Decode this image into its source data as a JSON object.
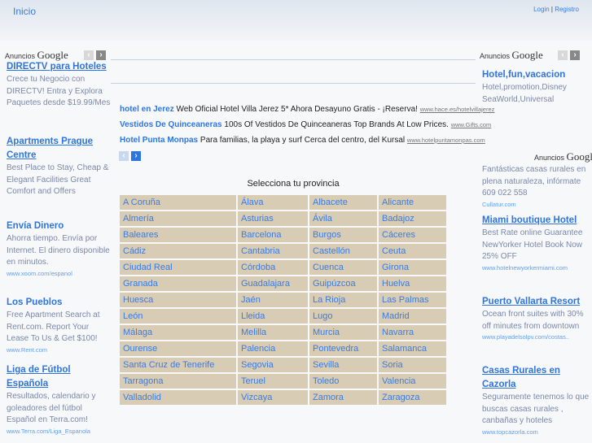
{
  "header": {
    "home": "Inicio",
    "login": "Login",
    "separator": "|",
    "register": "Registro"
  },
  "ads_label": {
    "prefix": "Anuncios",
    "brand": "Google"
  },
  "left_ads": [
    {
      "title": "DIRECTV para Hoteles",
      "desc": "Crece tu Negocio con DIRECTV! Entra y Explora Paquetes desde $19.99/Mes",
      "url": ""
    },
    {
      "title": "Apartments Prague Centre",
      "desc": "Best Place to Stay, Cheap & Elegant Facilities Great Comfort and Offers",
      "url": ""
    },
    {
      "title": "Envía Dinero",
      "desc": "Ahorra tiempo. Envía por Internet. El dinero disponible en minutos.",
      "url": "www.xoom.com/espanol"
    },
    {
      "title": "Los Pueblos",
      "desc": "Free Apartment Search at Rent.com. Report Your Lease To Us & Get $100!",
      "url": "www.Rent.com"
    },
    {
      "title": "Liga de Fútbol Española",
      "desc": "Resultados, calendario y goleadores del fútbol Español en Terra.com!",
      "url": "www.Terra.com/Liga_Espanola"
    }
  ],
  "right_ads_top": [
    {
      "title": "Hotel,fun,vacacion",
      "desc": "Hotel,promotion,Disney SeaWorld,Universal",
      "url": ""
    }
  ],
  "right_ads": [
    {
      "title": "",
      "desc": "Fantásticas casas rurales en plena naturaleza, infórmate 609 022 558",
      "url": "Cullatur.com"
    },
    {
      "title": "Miami boutique Hotel",
      "desc": "Best Rate online Guarantee NewYorker Hotel Book Now 25% OFF",
      "url": "www.hotelnewyorkermiami.com"
    },
    {
      "title": "Puerto Vallarta Resort",
      "desc": "Ocean front suites with 30% off minutes from downtown",
      "url": "www.playadelsolpv.com/costas.."
    },
    {
      "title": "Casas Rurales en Cazorla",
      "desc": "Seguramente tenemos lo que buscas casas rurales , canbañas y hoteles",
      "url": "www.topcazorla.com"
    }
  ],
  "text_ads": [
    {
      "title": "hotel en Jerez",
      "desc": "Web Oficial Hotel Villa Jerez 5* Ahora Desayuno Gratis - ¡Reserva!",
      "url": "www.hace.es/hotelvillajerez"
    },
    {
      "title": "Vestidos De Quinceaneras",
      "desc": "100s Of Vestidos De Quinceaneras Top Brands At Low Prices.",
      "url": "www.Gifts.com"
    },
    {
      "title": "Hotel Punta Monpas",
      "desc": "Para familias, la playa y surf Cerca del centro, del Kursal",
      "url": "www.hotelpuntamonpas.com"
    }
  ],
  "province_title": "Selecciona tu provincia",
  "provinces": [
    [
      "A Coruña",
      "Álava",
      "Albacete",
      "Alicante"
    ],
    [
      "Almería",
      "Asturias",
      "Ávila",
      "Badajoz"
    ],
    [
      "Baleares",
      "Barcelona",
      "Burgos",
      "Cáceres"
    ],
    [
      "Cádiz",
      "Cantabria",
      "Castellón",
      "Ceuta"
    ],
    [
      "Ciudad Real",
      "Córdoba",
      "Cuenca",
      "Girona"
    ],
    [
      "Granada",
      "Guadalajara",
      "Guipúzcoa",
      "Huelva"
    ],
    [
      "Huesca",
      "Jaén",
      "La Rioja",
      "Las Palmas"
    ],
    [
      "León",
      "Lleida",
      "Lugo",
      "Madrid"
    ],
    [
      "Málaga",
      "Melilla",
      "Murcia",
      "Navarra"
    ],
    [
      "Ourense",
      "Palencia",
      "Pontevedra",
      "Salamanca"
    ],
    [
      "Santa Cruz de Tenerife",
      "Segovia",
      "Sevilla",
      "Soria"
    ],
    [
      "Tarragona",
      "Teruel",
      "Toledo",
      "Valencia"
    ],
    [
      "Valladolid",
      "Vizcaya",
      "Zamora",
      "Zaragoza"
    ]
  ],
  "colors": {
    "link": "#2f75e0",
    "cell": "#d8ccb4",
    "nav_active": "#2f75e0"
  }
}
